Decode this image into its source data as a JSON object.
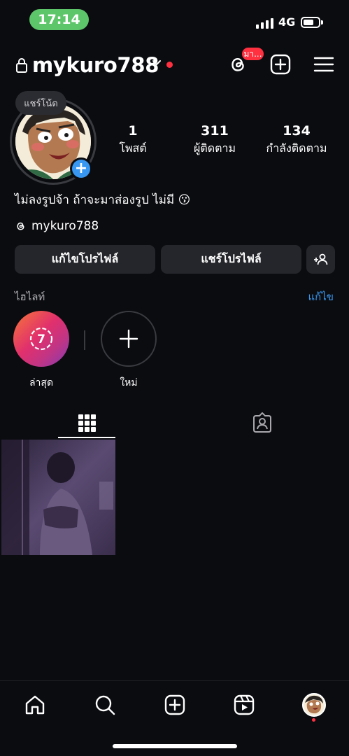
{
  "status_bar": {
    "time": "17:14",
    "network": "4G",
    "time_pill_color": "#5dc56a"
  },
  "header": {
    "username": "mykuro788",
    "threads_badge": "มา...",
    "icons": [
      "lock-icon",
      "chevron-down-icon",
      "threads-icon",
      "create-icon",
      "menu-icon"
    ]
  },
  "profile": {
    "note": "แชร์โน้ต",
    "stats": [
      {
        "value": "1",
        "label": "โพสต์"
      },
      {
        "value": "311",
        "label": "ผู้ติดตาม"
      },
      {
        "value": "134",
        "label": "กำลังติดตาม"
      }
    ],
    "bio": "ไม่ลงรูปจ้า ถ้าจะมาส่องรูป ไม่มี 😗",
    "threads_handle": "mykuro788"
  },
  "buttons": {
    "edit_profile": "แก้ไขโปรไฟล์",
    "share_profile": "แชร์โปรไฟล์"
  },
  "highlights": {
    "title": "ไฮไลท์",
    "edit": "แก้ไข",
    "items": [
      {
        "label": "ล่าสุด",
        "count": "7"
      },
      {
        "label": "ใหม่"
      }
    ]
  },
  "tabs": [
    "grid-icon",
    "tagged-icon"
  ],
  "bottom_nav": [
    "home-icon",
    "search-icon",
    "create-icon",
    "reels-icon",
    "profile-avatar"
  ],
  "colors": {
    "accent": "#3897f0",
    "badge": "#ff3040",
    "background": "#0b0c10",
    "button": "#25262b"
  }
}
